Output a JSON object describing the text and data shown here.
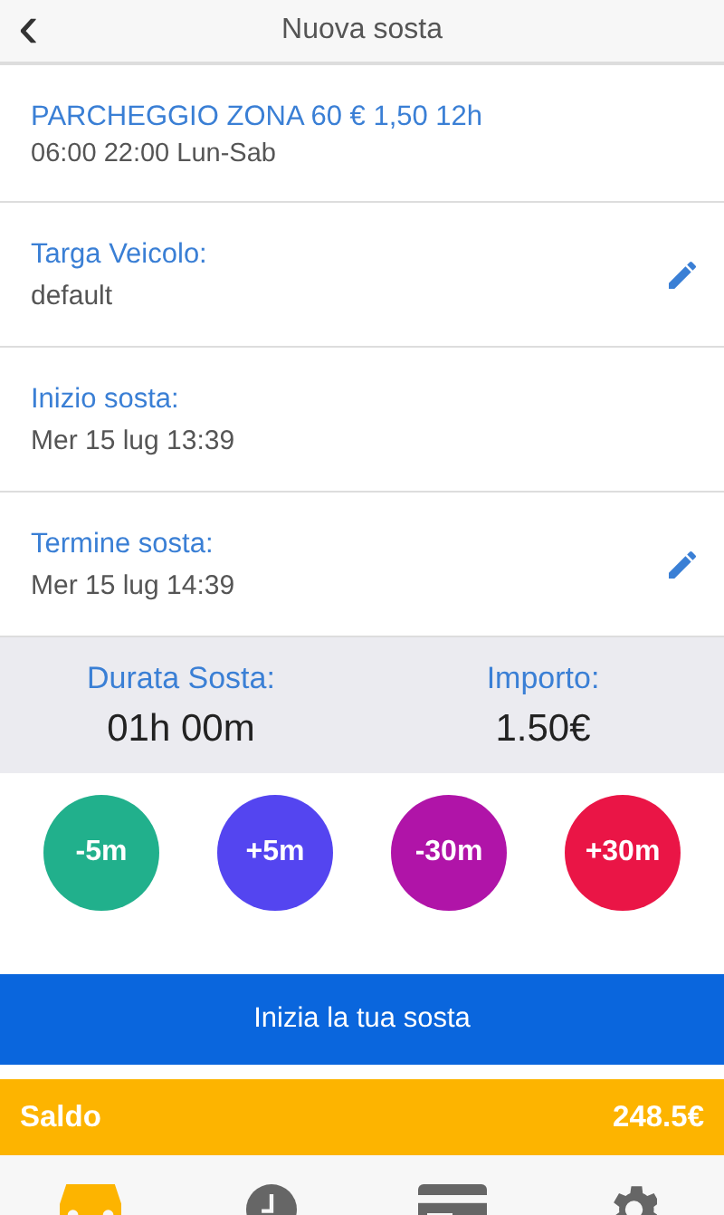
{
  "header": {
    "back": "‹",
    "title": "Nuova sosta"
  },
  "zone": {
    "title": "PARCHEGGIO ZONA 60 € 1,50 12h",
    "hours": "06:00 22:00 Lun-Sab"
  },
  "rows": [
    {
      "label": "Targa Veicolo:",
      "value": "default",
      "editable": true
    },
    {
      "label": "Inizio sosta:",
      "value": "Mer 15 lug 13:39",
      "editable": false
    },
    {
      "label": "Termine sosta:",
      "value": "Mer 15 lug 14:39",
      "editable": true
    }
  ],
  "summary": [
    {
      "label": "Durata Sosta:",
      "value": "01h 00m"
    },
    {
      "label": "Importo:",
      "value": "1.50€"
    }
  ],
  "adjust_buttons": [
    {
      "label": "-5m",
      "color": "#21b08c"
    },
    {
      "label": "+5m",
      "color": "#5445f0"
    },
    {
      "label": "-30m",
      "color": "#b014a8"
    },
    {
      "label": "+30m",
      "color": "#ea1546"
    }
  ],
  "start_button": "Inizia la tua sosta",
  "balance": {
    "label": "Saldo",
    "value": "248.5€"
  },
  "tabs": [
    {
      "kind": "car",
      "selected": true
    },
    {
      "kind": "clock",
      "selected": false
    },
    {
      "kind": "card",
      "selected": false
    },
    {
      "kind": "gear",
      "selected": false
    }
  ]
}
